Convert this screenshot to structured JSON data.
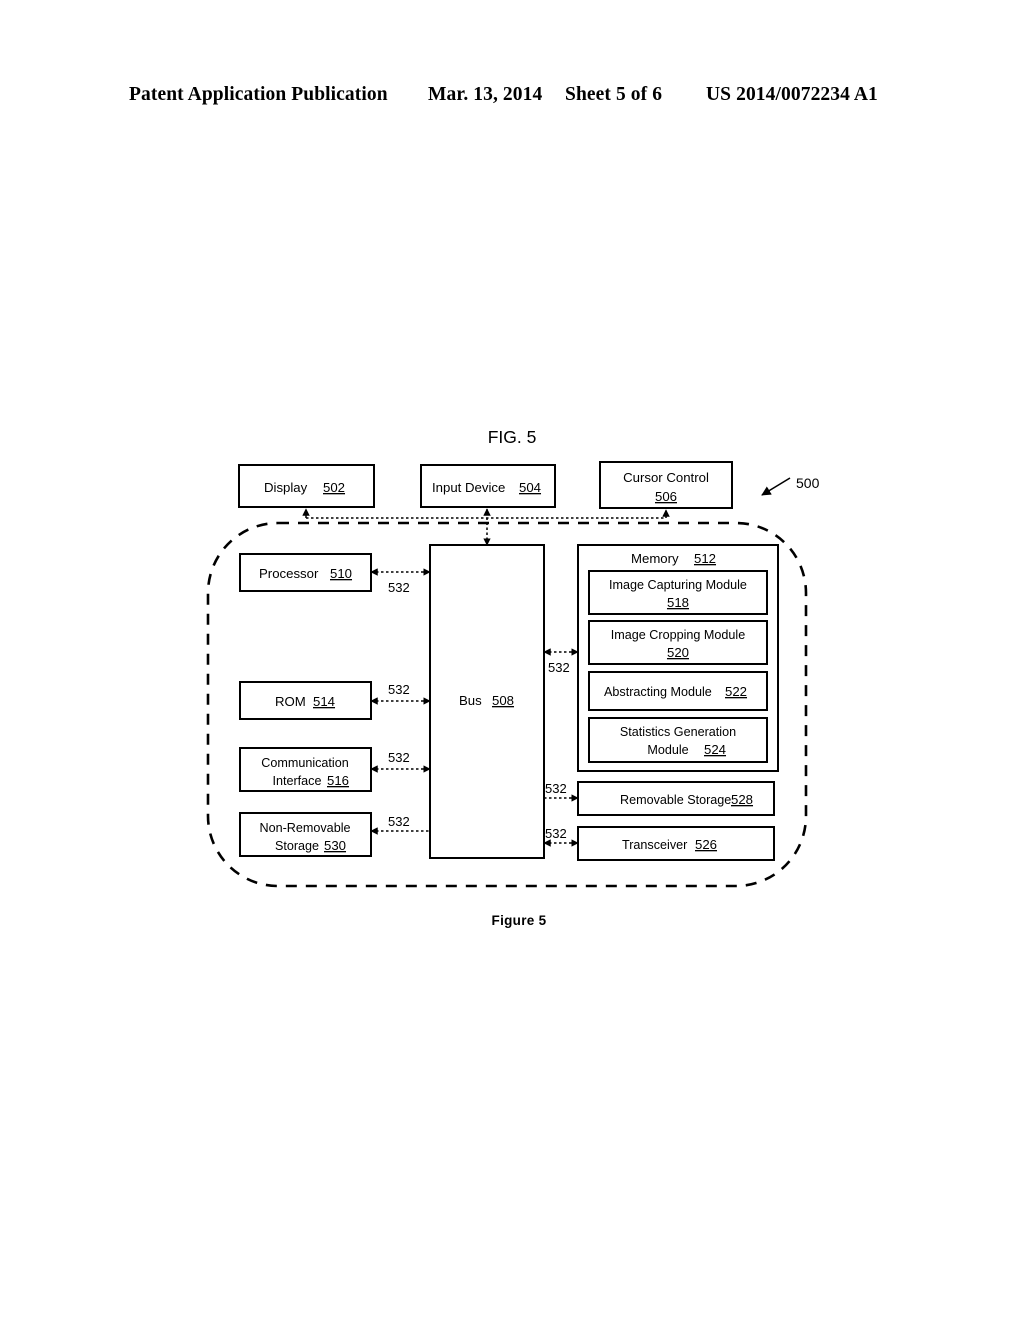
{
  "header": {
    "publication": "Patent Application Publication",
    "date": "Mar. 13, 2014",
    "sheet": "Sheet 5 of 6",
    "document_number": "US 2014/0072234 A1"
  },
  "figure": {
    "title": "FIG. 5",
    "caption": "Figure 5",
    "system_ref": "500",
    "connector_label": "532"
  },
  "peripherals": [
    {
      "label": "Display",
      "ref": "502"
    },
    {
      "label": "Input Device",
      "ref": "504"
    },
    {
      "label": "Cursor Control",
      "ref": "506"
    }
  ],
  "bus": {
    "label": "Bus",
    "ref": "508"
  },
  "left_column": [
    {
      "label": "Processor",
      "ref": "510"
    },
    {
      "label": "ROM",
      "ref": "514"
    },
    {
      "label": "Communication Interface",
      "ref": "516"
    },
    {
      "label": "Non-Removable Storage",
      "ref": "530"
    }
  ],
  "memory": {
    "label": "Memory",
    "ref": "512",
    "modules": [
      {
        "label": "Image Capturing Module",
        "ref": "518"
      },
      {
        "label": "Image Cropping Module",
        "ref": "520"
      },
      {
        "label": "Abstracting Module",
        "ref": "522"
      },
      {
        "label": "Statistics Generation Module",
        "ref": "524"
      }
    ]
  },
  "right_column": [
    {
      "label": "Removable Storage",
      "ref": "528"
    },
    {
      "label": "Transceiver",
      "ref": "526"
    }
  ]
}
